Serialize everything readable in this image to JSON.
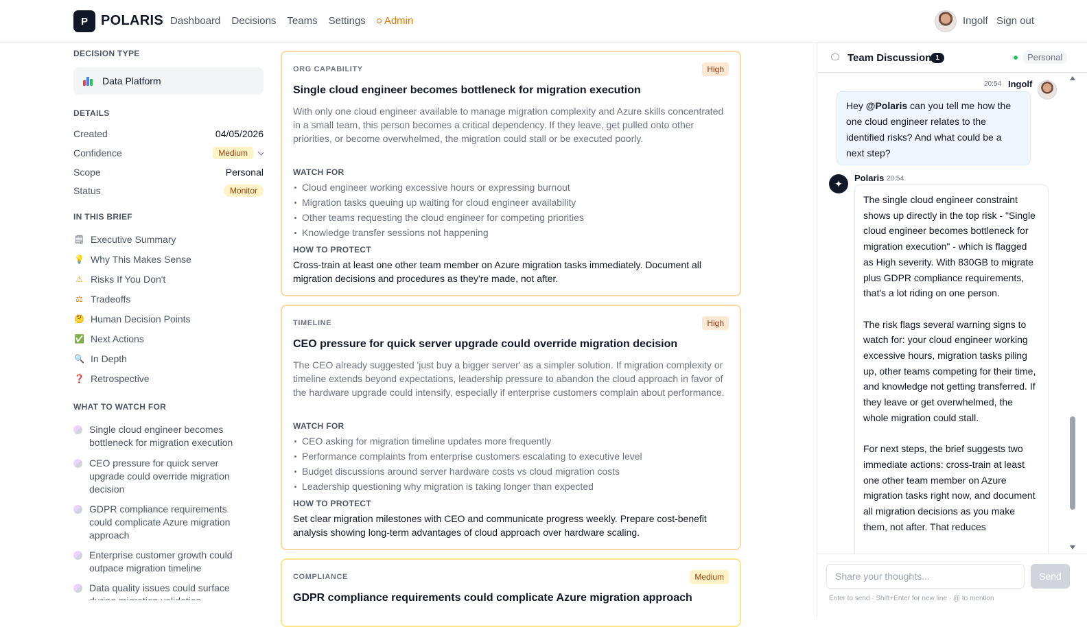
{
  "header": {
    "logo_letter": "P",
    "brand": "POLARIS",
    "nav": [
      "Dashboard",
      "Decisions",
      "Teams",
      "Settings"
    ],
    "admin": "Admin",
    "user_name": "Ingolf",
    "sign_out": "Sign out"
  },
  "sidebar": {
    "decision_type_title": "DECISION TYPE",
    "decision_type": "Data Platform",
    "details_title": "DETAILS",
    "details": [
      {
        "label": "Created",
        "value": "04/05/2026"
      },
      {
        "label": "Confidence",
        "value": "Medium"
      },
      {
        "label": "Scope",
        "value": "Personal"
      },
      {
        "label": "Status",
        "value": "Monitor"
      }
    ],
    "brief_title": "IN THIS BRIEF",
    "brief": [
      {
        "icon": "memo-icon",
        "glyph": "🗒",
        "label": "Executive Summary"
      },
      {
        "icon": "lightbulb-icon",
        "glyph": "💡",
        "label": "Why This Makes Sense"
      },
      {
        "icon": "warning-icon",
        "glyph": "⚠",
        "label": "Risks If You Don't"
      },
      {
        "icon": "scale-icon",
        "glyph": "⚖",
        "label": "Tradeoffs"
      },
      {
        "icon": "thinking-face-icon",
        "glyph": "🤔",
        "label": "Human Decision Points"
      },
      {
        "icon": "check-box-icon",
        "glyph": "✅",
        "label": "Next Actions"
      },
      {
        "icon": "magnifier-icon",
        "glyph": "🔍",
        "label": "In Depth"
      },
      {
        "icon": "question-icon",
        "glyph": "❓",
        "label": "Retrospective"
      }
    ],
    "watch_title": "WHAT TO WATCH FOR",
    "watch": [
      "Single cloud engineer becomes bottleneck for migration execution",
      "CEO pressure for quick server upgrade could override migration decision",
      "GDPR compliance requirements could complicate Azure migration approach",
      "Enterprise customer growth could outpace migration timeline",
      "Data quality issues could surface during migration validation"
    ]
  },
  "cards": [
    {
      "category": "ORG CAPABILITY",
      "severity": "High",
      "title": "Single cloud engineer becomes bottleneck for migration execution",
      "description": "With only one cloud engineer available to manage migration complexity and Azure skills concentrated in a small team, this person becomes a critical dependency. If they leave, get pulled onto other priorities, or become overwhelmed, the migration could stall or be executed poorly.",
      "watch_label": "WATCH FOR",
      "watch": [
        "Cloud engineer working excessive hours or expressing burnout",
        "Migration tasks queuing up waiting for cloud engineer availability",
        "Other teams requesting the cloud engineer for competing priorities",
        "Knowledge transfer sessions not happening"
      ],
      "protect_label": "HOW TO PROTECT",
      "protect": "Cross-train at least one other team member on Azure migration tasks immediately. Document all migration decisions and procedures as they're made, not after."
    },
    {
      "category": "TIMELINE",
      "severity": "High",
      "title": "CEO pressure for quick server upgrade could override migration decision",
      "description": "The CEO already suggested 'just buy a bigger server' as a simpler solution. If migration complexity or timeline extends beyond expectations, leadership pressure to abandon the cloud approach in favor of the hardware upgrade could intensify, especially if enterprise customers complain about performance.",
      "watch_label": "WATCH FOR",
      "watch": [
        "CEO asking for migration timeline updates more frequently",
        "Performance complaints from enterprise customers escalating to executive level",
        "Budget discussions around server hardware costs vs cloud migration costs",
        "Leadership questioning why migration is taking longer than expected"
      ],
      "protect_label": "HOW TO PROTECT",
      "protect": "Set clear migration milestones with CEO and communicate progress weekly. Prepare cost-benefit analysis showing long-term advantages of cloud approach over hardware scaling."
    },
    {
      "category": "COMPLIANCE",
      "severity": "Medium",
      "title": "GDPR compliance requirements could complicate Azure migration approach"
    }
  ],
  "discussion": {
    "title": "Team Discussion",
    "count": "1",
    "scope": "Personal",
    "user_msg": {
      "time": "20:54",
      "name": "Ingolf",
      "pre": "Hey ",
      "mention": "@Polaris",
      "post": " can you tell me how the one cloud engineer relates to the identified risks? And what could be a next step?"
    },
    "ai_msg": {
      "name": "Polaris",
      "time": "20:54",
      "p1": "The single cloud engineer constraint shows up directly in the top risk - \"Single cloud engineer becomes bottleneck for migration execution\" - which is flagged as High severity. With 830GB to migrate plus GDPR compliance requirements, that's a lot riding on one person.",
      "p2": "The risk flags several warning signs to watch for: your cloud engineer working excessive hours, migration tasks piling up, other teams competing for their time, and knowledge not getting transferred. If they leave or get overwhelmed, the whole migration could stall.",
      "p3": "For next steps, the brief suggests two immediate actions: cross-train at least one other team member on Azure migration tasks right now, and document all migration decisions as you make them, not after. That reduces"
    },
    "input_placeholder": "Share your thoughts...",
    "send_label": "Send",
    "hint": "Enter to send · Shift+Enter for new line · @ to mention"
  }
}
